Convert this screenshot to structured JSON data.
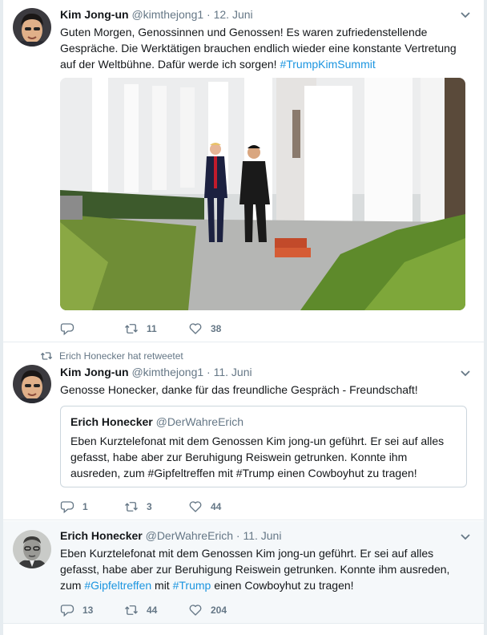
{
  "tweets": [
    {
      "name": "Kim Jong-un",
      "handle": "@kimthejong1",
      "sep": "·",
      "date": "12. Juni",
      "text": "Guten Morgen, Genossinnen und Genossen! Es waren zufriedenstellende Gespräche. Die Werktätigen brauchen endlich wieder eine konstante Vertretung auf der Weltbühne. Dafür werde ich sorgen! ",
      "hashtag": "#TrumpKimSummit",
      "reply_count": "",
      "retweet_count": "11",
      "like_count": "38"
    },
    {
      "retweet_context": "Erich Honecker hat retweetet",
      "name": "Kim Jong-un",
      "handle": "@kimthejong1",
      "sep": "·",
      "date": "11. Juni",
      "text": "Genosse Honecker, danke für das freundliche Gespräch - Freundschaft!",
      "quote": {
        "name": "Erich Honecker",
        "handle": "@DerWahreErich",
        "text": "Eben Kurztelefonat mit dem Genossen Kim jong-un geführt. Er sei auf alles gefasst, habe aber zur Beruhigung Reiswein getrunken. Konnte ihm ausreden, zum #Gipfeltreffen mit #Trump einen Cowboyhut zu tragen!"
      },
      "reply_count": "1",
      "retweet_count": "3",
      "like_count": "44"
    },
    {
      "name": "Erich Honecker",
      "handle": "@DerWahreErich",
      "sep": "·",
      "date": "11. Juni",
      "text_parts": [
        "Eben Kurztelefonat mit dem Genossen Kim jong-un geführt. Er sei auf alles gefasst, habe aber zur Beruhigung Reiswein getrunken. Konnte ihm ausreden, zum ",
        "#Gipfeltreffen",
        " mit ",
        "#Trump",
        " einen Cowboyhut zu tragen!"
      ],
      "reply_count": "13",
      "retweet_count": "44",
      "like_count": "204"
    }
  ],
  "icons": {
    "reply": "reply-icon",
    "retweet": "retweet-icon",
    "like": "heart-icon",
    "caret": "chevron-down-icon"
  },
  "colors": {
    "link": "#1b95e0",
    "muted": "#657786",
    "highlight_bg": "#f5f8fa"
  }
}
